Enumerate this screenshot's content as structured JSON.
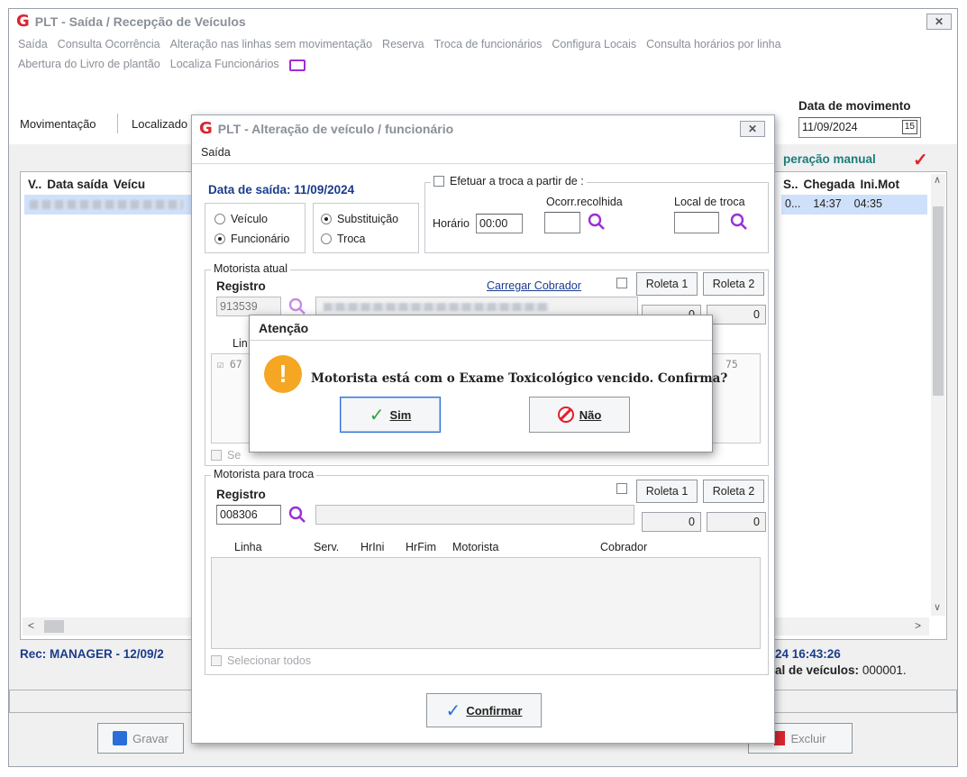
{
  "main": {
    "title": "PLT - Saída / Recepção de Veículos",
    "close_label": "✕",
    "menu1": [
      "Saída",
      "Consulta Ocorrência",
      "Alteração nas linhas sem movimentação",
      "Reserva",
      "Troca de funcionários",
      "Configura Locais",
      "Consulta horários por linha"
    ],
    "menu2": [
      "Abertura do Livro de plantão",
      "Localiza Funcionários"
    ],
    "tabs": [
      "Movimentação",
      "Localizado"
    ],
    "data_movimento_label": "Data de movimento",
    "data_movimento_value": "11/09/2024",
    "calendar_label": "15",
    "operacao_label": "peração manual",
    "table_headers_left": [
      "V..",
      "Data saída",
      "Veícu"
    ],
    "table_headers_right": [
      "S..",
      "Chegada",
      "Ini.Mot"
    ],
    "row_right": [
      "0...",
      "14:37",
      "04:35"
    ],
    "rec_label": "Rec: MANAGER - 12/09/2",
    "timestamp_right": "24 16:43:26",
    "total_label": "al de veículos:",
    "total_value": "000001.",
    "buttons": {
      "gravar": "Gravar",
      "excluir": "Excluir"
    }
  },
  "dialog": {
    "title": "PLT - Alteração de veículo / funcionário",
    "close_label": "✕",
    "menu": "Saída",
    "data_saida": "Data de saída: 11/09/2024",
    "radios_a": [
      "Veículo",
      "Funcionário"
    ],
    "radios_b": [
      "Substituição",
      "Troca"
    ],
    "efetuar_label": "Efetuar a troca a partir de :",
    "horario_label": "Horário",
    "horario_value": "00:00",
    "ocorr_label": "Ocorr.recolhida",
    "local_label": "Local de troca",
    "atual": {
      "group_label": "Motorista atual",
      "registro_label": "Registro",
      "registro_value": "913539",
      "carregar": "Carregar Cobrador",
      "roleta1": "Roleta 1",
      "roleta2": "Roleta 2",
      "num1": "0",
      "num2": "0",
      "linha_prefix": "Lin",
      "item_prefix": "67",
      "item_suffix": "75",
      "sel_prefix": "Se"
    },
    "troca": {
      "group_label": "Motorista para troca",
      "registro_label": "Registro",
      "registro_value": "008306",
      "roleta1": "Roleta 1",
      "roleta2": "Roleta 2",
      "num1": "0",
      "num2": "0",
      "columns": [
        "Linha",
        "Serv.",
        "HrIni",
        "HrFim",
        "Motorista",
        "Cobrador"
      ],
      "selecionar": "Selecionar todos"
    },
    "confirmar": "Confirmar"
  },
  "alert": {
    "title": "Atenção",
    "message": "Motorista está com o Exame Toxicológico vencido. Confirma?",
    "yes": "Sim",
    "no": "Não"
  },
  "colors": {
    "accent": "#2a6fd8",
    "logo": "#d9262e",
    "title_blue": "#1a3c8c",
    "warning": "#f5a623",
    "teal": "#1b7d7a"
  }
}
